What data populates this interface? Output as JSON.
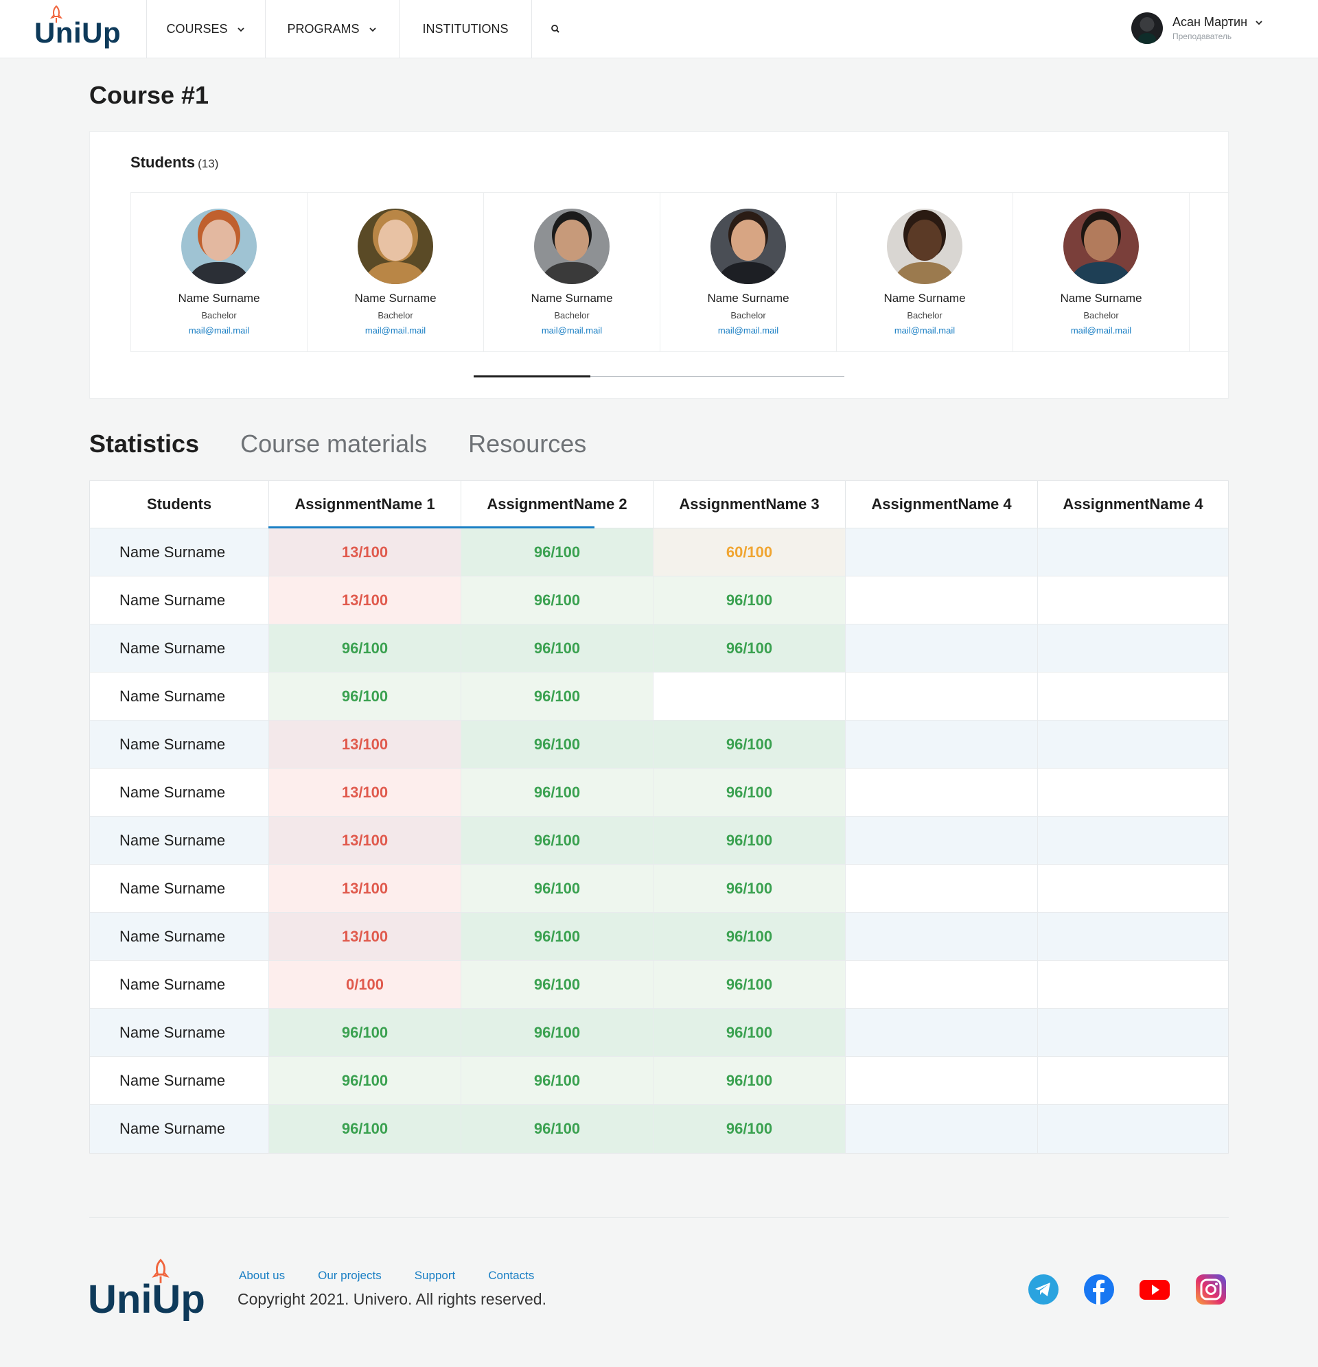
{
  "header": {
    "logo": "UniUp",
    "nav": {
      "courses": "COURSES",
      "programs": "PROGRAMS",
      "institutions": "INSTITUTIONS"
    },
    "user": {
      "name": "Асан Мартин",
      "role": "Преподаватель"
    }
  },
  "page": {
    "title": "Course #1"
  },
  "students": {
    "heading": "Students",
    "count": "(13)",
    "items": [
      {
        "name": "Name Surname",
        "degree": "Bachelor",
        "email": "mail@mail.mail"
      },
      {
        "name": "Name Surname",
        "degree": "Bachelor",
        "email": "mail@mail.mail"
      },
      {
        "name": "Name Surname",
        "degree": "Bachelor",
        "email": "mail@mail.mail"
      },
      {
        "name": "Name Surname",
        "degree": "Bachelor",
        "email": "mail@mail.mail"
      },
      {
        "name": "Name Surname",
        "degree": "Bachelor",
        "email": "mail@mail.mail"
      },
      {
        "name": "Name Surname",
        "degree": "Bachelor",
        "email": "mail@mail.mail"
      }
    ]
  },
  "tabs": {
    "statistics": "Statistics",
    "materials": "Course materials",
    "resources": "Resources"
  },
  "table": {
    "headers": [
      "Students",
      "AssignmentName 1",
      "AssignmentName 2",
      "AssignmentName 3",
      "AssignmentName 4",
      "AssignmentName 4"
    ],
    "rows": [
      {
        "name": "Name Surname",
        "grades": [
          "13/100",
          "96/100",
          "60/100",
          "",
          ""
        ]
      },
      {
        "name": "Name Surname",
        "grades": [
          "13/100",
          "96/100",
          "96/100",
          "",
          ""
        ]
      },
      {
        "name": "Name Surname",
        "grades": [
          "96/100",
          "96/100",
          "96/100",
          "",
          ""
        ]
      },
      {
        "name": "Name Surname",
        "grades": [
          "96/100",
          "96/100",
          "",
          "",
          ""
        ]
      },
      {
        "name": "Name Surname",
        "grades": [
          "13/100",
          "96/100",
          "96/100",
          "",
          ""
        ]
      },
      {
        "name": "Name Surname",
        "grades": [
          "13/100",
          "96/100",
          "96/100",
          "",
          ""
        ]
      },
      {
        "name": "Name Surname",
        "grades": [
          "13/100",
          "96/100",
          "96/100",
          "",
          ""
        ]
      },
      {
        "name": "Name Surname",
        "grades": [
          "13/100",
          "96/100",
          "96/100",
          "",
          ""
        ]
      },
      {
        "name": "Name Surname",
        "grades": [
          "13/100",
          "96/100",
          "96/100",
          "",
          ""
        ]
      },
      {
        "name": "Name Surname",
        "grades": [
          "0/100",
          "96/100",
          "96/100",
          "",
          ""
        ]
      },
      {
        "name": "Name Surname",
        "grades": [
          "96/100",
          "96/100",
          "96/100",
          "",
          ""
        ]
      },
      {
        "name": "Name Surname",
        "grades": [
          "96/100",
          "96/100",
          "96/100",
          "",
          ""
        ]
      },
      {
        "name": "Name Surname",
        "grades": [
          "96/100",
          "96/100",
          "96/100",
          "",
          ""
        ]
      }
    ]
  },
  "footer": {
    "logo": "UniUp",
    "links": {
      "about": "About us",
      "projects": "Our projects",
      "support": "Support",
      "contacts": "Contacts"
    },
    "copyright": "Copyright 2021. Univero. All rights reserved."
  },
  "colors": {
    "brand": "#0e3a5a",
    "accent": "#1a7fc4",
    "rocket": "#f0643c",
    "grade_low": "#e05a4d",
    "grade_mid": "#f0a531",
    "grade_high": "#3aa150"
  },
  "icons": [
    "chevron-down-icon",
    "search-icon",
    "rocket-icon",
    "telegram-icon",
    "facebook-icon",
    "youtube-icon",
    "instagram-icon"
  ]
}
